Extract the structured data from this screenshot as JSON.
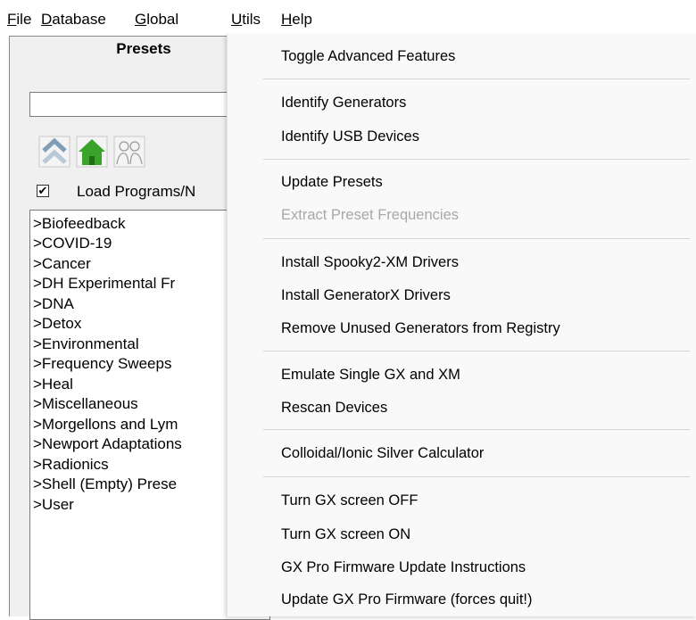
{
  "menubar": {
    "items": [
      {
        "key": "F",
        "rest": "ile"
      },
      {
        "key": "D",
        "rest": "atabase"
      },
      {
        "key": "G",
        "rest": "lobal"
      },
      {
        "key": "U",
        "rest": "tils"
      },
      {
        "key": "H",
        "rest": "elp"
      }
    ]
  },
  "panel": {
    "title": "Presets",
    "search_value": "",
    "icons": [
      "up-chevrons-icon",
      "home-icon",
      "people-icon"
    ],
    "checkbox": {
      "checked": true,
      "mark": "✔",
      "label": "Load Programs/N"
    },
    "list": [
      ">Biofeedback",
      ">COVID-19",
      ">Cancer",
      ">DH Experimental Fr",
      ">DNA",
      ">Detox",
      ">Environmental",
      ">Frequency Sweeps",
      ">Heal",
      ">Miscellaneous",
      ">Morgellons and Lym",
      ">Newport Adaptations",
      ">Radionics",
      ">Shell (Empty) Prese",
      ">User"
    ]
  },
  "utils_menu": {
    "items": [
      {
        "label": "Toggle Advanced Features",
        "enabled": true
      },
      {
        "label": "Identify Generators",
        "enabled": true
      },
      {
        "label": "Identify USB Devices",
        "enabled": true
      },
      {
        "label": "Update Presets",
        "enabled": true
      },
      {
        "label": "Extract Preset Frequencies",
        "enabled": false
      },
      {
        "label": "Install Spooky2-XM Drivers",
        "enabled": true
      },
      {
        "label": "Install GeneratorX Drivers",
        "enabled": true
      },
      {
        "label": "Remove Unused Generators from Registry",
        "enabled": true
      },
      {
        "label": "Emulate Single GX and XM",
        "enabled": true
      },
      {
        "label": "Rescan Devices",
        "enabled": true
      },
      {
        "label": "Colloidal/Ionic Silver Calculator",
        "enabled": true
      },
      {
        "label": "Turn GX screen OFF",
        "enabled": true
      },
      {
        "label": "Turn GX screen ON",
        "enabled": true
      },
      {
        "label": "GX Pro Firmware Update Instructions",
        "enabled": true
      },
      {
        "label": "Update GX Pro Firmware (forces quit!)",
        "enabled": true
      }
    ]
  },
  "colors": {
    "menu_bg": "#f9f9f9",
    "disabled_text": "#a8a8a8",
    "home_icon": "#3aa32a",
    "chevron_icon": "#7f9db5"
  }
}
